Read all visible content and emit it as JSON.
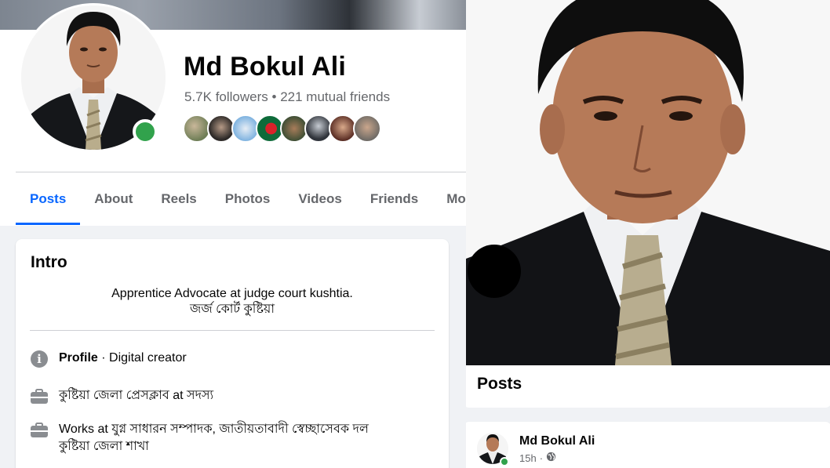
{
  "profile": {
    "name": "Md Bokul Ali",
    "followers": "5.7K followers",
    "separator": "•",
    "mutual_friends": "221 mutual friends"
  },
  "tabs": [
    {
      "label": "Posts",
      "active": true
    },
    {
      "label": "About"
    },
    {
      "label": "Reels"
    },
    {
      "label": "Photos"
    },
    {
      "label": "Videos"
    },
    {
      "label": "Friends"
    },
    {
      "label": "More"
    }
  ],
  "intro": {
    "title": "Intro",
    "bio_line1": "Apprentice Advocate at judge court kushtia.",
    "bio_line2": "জর্জ কোর্ট কুষ্টিয়া",
    "profile_label": "Profile",
    "profile_sep": " · ",
    "profile_value": "Digital creator",
    "work1": "কুষ্টিয়া জেলা প্রেসক্লাব at সদস্য",
    "work2_line1": "Works at যুগ্ন সাধারন সম্পাদক, জাতীয়তাবাদী স্বেচ্ছাসেবক দল",
    "work2_line2": "কুষ্টিয়া জেলা শাখা"
  },
  "posts_section": {
    "title": "Posts"
  },
  "post": {
    "author": "Md Bokul Ali",
    "time": "15h",
    "dot": "·",
    "privacy_icon": "globe-icon"
  },
  "colors": {
    "accent": "#0866ff",
    "online": "#31a24c",
    "muted_text": "#65676b"
  }
}
